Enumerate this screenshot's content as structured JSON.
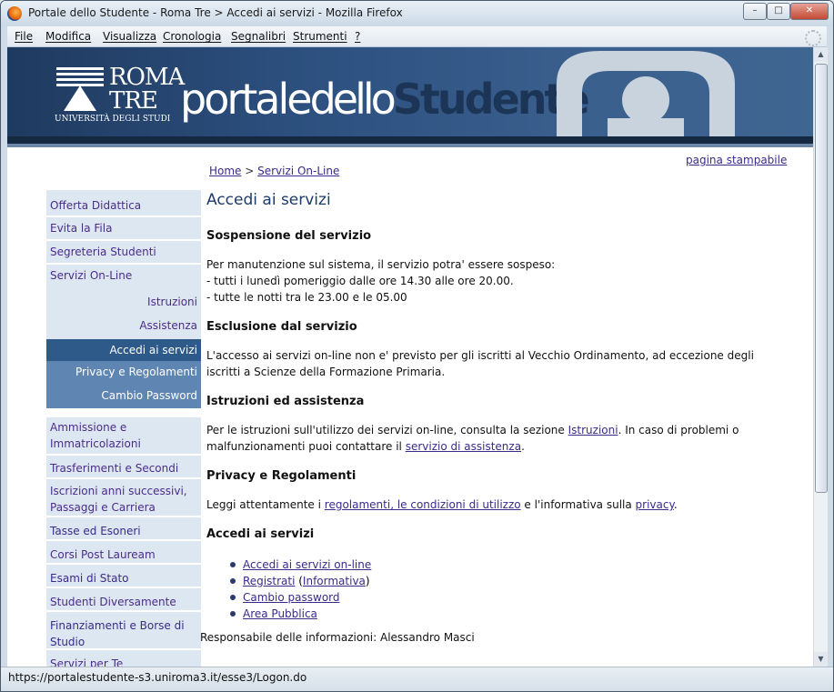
{
  "window": {
    "title": "Portale dello Studente - Roma Tre > Accedi ai servizi - Mozilla Firefox",
    "buttons": {
      "minimize": "–",
      "maximize": "□",
      "close": "✕"
    }
  },
  "menubar": {
    "items": [
      "File",
      "Modifica",
      "Visualizza",
      "Cronologia",
      "Segnalibri",
      "Strumenti",
      "?"
    ]
  },
  "header": {
    "logo_line1": "ROMA",
    "logo_line2": "TRE",
    "logo_line3": "UNIVERSITÀ DEGLI STUDI",
    "portal_part1": "portale",
    "portal_part2": "dello",
    "portal_part3": "Studente"
  },
  "print_link": "pagina stampabile",
  "breadcrumb": {
    "home": "Home",
    "sep": " > ",
    "current": "Servizi On-Line"
  },
  "sidebar": {
    "offerta": "Offerta Didattica",
    "evita": "Evita la Fila",
    "segreteria": "Segreteria Studenti",
    "servizi": "Servizi On-Line",
    "istruzioni": "Istruzioni",
    "assistenza": "Assistenza",
    "accedi": "Accedi ai servizi",
    "privacy": "Privacy e Regolamenti",
    "cambio": "Cambio Password",
    "ammissione": "Ammissione e Immatricolazioni",
    "trasferimenti": "Trasferimenti e Secondi Titoli",
    "iscrizioni": "Iscrizioni anni successivi, Passaggi e Carriera",
    "tasse": "Tasse ed Esoneri",
    "corsi": "Corsi Post Lauream",
    "esami": "Esami di Stato",
    "studenti": "Studenti Diversamente Abili",
    "finanziamenti": "Finanziamenti e Borse di Studio",
    "servizi_per_te": "Servizi per Te"
  },
  "content": {
    "title": "Accedi ai servizi",
    "s1_title": "Sospensione del servizio",
    "s1_p1": "Per manutenzione sul sistema, il servizio potra' essere sospeso:",
    "s1_p2": "- tutti i lunedì pomeriggio dalle ore 14.30 alle ore 20.00.",
    "s1_p3": "- tutte le notti tra le 23.00 e le 05.00",
    "s2_title": "Esclusione dal servizio",
    "s2_p": "L'accesso ai servizi on-line non e' previsto per gli iscritti al Vecchio Ordinamento, ad eccezione degli iscritti a Scienze della Formazione Primaria.",
    "s3_title": "Istruzioni ed assistenza",
    "s3_a": "Per le istruzioni sull'utilizzo dei servizi on-line, consulta la sezione ",
    "s3_link1": "Istruzioni",
    "s3_b": ". In caso di problemi o malfunzionamenti puoi contattare il ",
    "s3_link2": "servizio di assistenza",
    "s3_c": ".",
    "s4_title": "Privacy e Regolamenti",
    "s4_a": "Leggi attentamente i ",
    "s4_link1": "regolamenti, le condizioni di utilizzo",
    "s4_b": " e l'informativa sulla ",
    "s4_link2": "privacy",
    "s4_c": ".",
    "s5_title": "Accedi ai servizi",
    "links": {
      "accedi": "Accedi ai servizi on-line",
      "registrati": "Registrati",
      "paren_open": " (",
      "informativa": "Informativa",
      "paren_close": ")",
      "cambio": "Cambio password",
      "area": "Area Pubblica"
    },
    "responsabile": "Responsabile delle informazioni: Alessandro Masci"
  },
  "statusbar": {
    "url": "https://portalestudente-s3.uniroma3.it/esse3/Logon.do"
  }
}
